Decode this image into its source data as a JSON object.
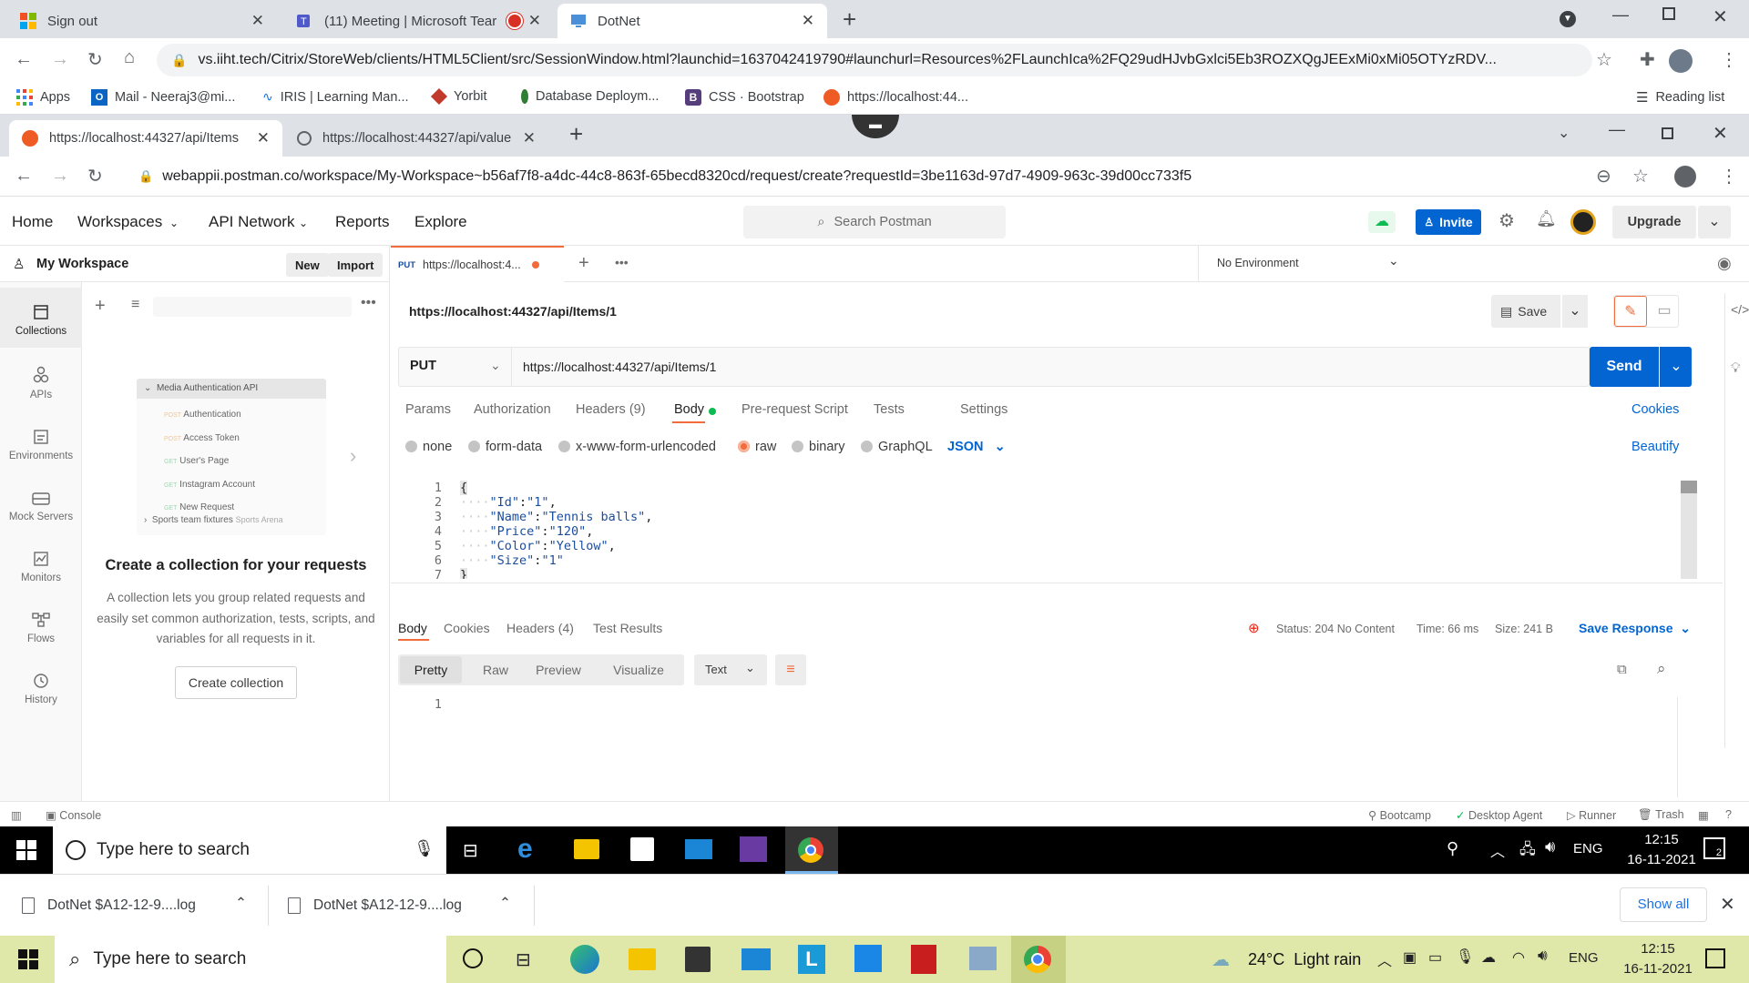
{
  "outer_browser": {
    "tabs": [
      {
        "title": "Sign out"
      },
      {
        "title": "(11) Meeting | Microsoft Tear"
      },
      {
        "title": "DotNet"
      }
    ],
    "url": "vs.iiht.tech/Citrix/StoreWeb/clients/HTML5Client/src/SessionWindow.html?launchid=1637042419790#launchurl=Resources%2FLaunchIca%2FQ29udHJvbGxlci5Eb3ROZXQgJEExMi0xMi05OTYzRDV...",
    "bookmarks": [
      {
        "label": "Apps"
      },
      {
        "label": "Mail - Neeraj3@mi..."
      },
      {
        "label": "IRIS | Learning Man..."
      },
      {
        "label": "Yorbit"
      },
      {
        "label": "Database Deploym..."
      },
      {
        "label": "CSS · Bootstrap"
      },
      {
        "label": "https://localhost:44..."
      }
    ],
    "reading_list": "Reading list"
  },
  "inner_browser": {
    "tabs": [
      {
        "title": "https://localhost:44327/api/Items"
      },
      {
        "title": "https://localhost:44327/api/value"
      }
    ],
    "url": "webappii.postman.co/workspace/My-Workspace~b56af7f8-a4dc-44c8-863f-65becd8320cd/request/create?requestId=3be1163d-97d7-4909-963c-39d00cc733f5"
  },
  "postman": {
    "nav": [
      "Home",
      "Workspaces",
      "API Network",
      "Reports",
      "Explore"
    ],
    "search_placeholder": "Search Postman",
    "invite": "Invite",
    "upgrade": "Upgrade",
    "workspace": {
      "title": "My Workspace",
      "new": "New",
      "import": "Import"
    },
    "rail": [
      "Collections",
      "APIs",
      "Environments",
      "Mock Servers",
      "Monitors",
      "Flows",
      "History"
    ],
    "illustration": {
      "folder": "Media Authentication API",
      "items": [
        {
          "method": "POST",
          "name": "Authentication"
        },
        {
          "method": "POST",
          "name": "Access Token"
        },
        {
          "method": "GET",
          "name": "User's Page"
        },
        {
          "method": "GET",
          "name": "Instagram Account"
        },
        {
          "method": "GET",
          "name": "New Request"
        }
      ],
      "folder2": "Sports team fixtures",
      "folder2_tag": "Sports Arena"
    },
    "empty_state": {
      "title": "Create a collection for your requests",
      "text": "A collection lets you group related requests and easily set common authorization, tests, scripts, and variables for all requests in it.",
      "button": "Create collection"
    },
    "request_tab": {
      "method": "PUT",
      "label": "https://localhost:4..."
    },
    "environment": "No Environment",
    "request_title": "https://localhost:44327/api/Items/1",
    "save": "Save",
    "method": "PUT",
    "url": "https://localhost:44327/api/Items/1",
    "send": "Send",
    "request_tabs": [
      "Params",
      "Authorization",
      "Headers (9)",
      "Body",
      "Pre-request Script",
      "Tests",
      "Settings"
    ],
    "cookies": "Cookies",
    "body_types": [
      "none",
      "form-data",
      "x-www-form-urlencoded",
      "raw",
      "binary",
      "GraphQL"
    ],
    "body_format": "JSON",
    "beautify": "Beautify",
    "body_lines": [
      {
        "n": "1",
        "text": "{"
      },
      {
        "n": "2",
        "key": "\"Id\"",
        "val": "\"1\"",
        "comma": ","
      },
      {
        "n": "3",
        "key": "\"Name\"",
        "val": "\"Tennis balls\"",
        "comma": ","
      },
      {
        "n": "4",
        "key": "\"Price\"",
        "val": "\"120\"",
        "comma": ","
      },
      {
        "n": "5",
        "key": "\"Color\"",
        "val": "\"Yellow\"",
        "comma": ","
      },
      {
        "n": "6",
        "key": "\"Size\"",
        "val": "\"1\"",
        "comma": ""
      },
      {
        "n": "7",
        "text": "}"
      }
    ],
    "response_tabs": [
      "Body",
      "Cookies",
      "Headers (4)",
      "Test Results"
    ],
    "status": "Status: 204 No Content",
    "time": "Time: 66 ms",
    "size": "Size: 241 B",
    "save_response": "Save Response",
    "view_modes": [
      "Pretty",
      "Raw",
      "Preview",
      "Visualize"
    ],
    "view_format": "Text",
    "response_line": "1",
    "status_bar": {
      "console": "Console",
      "right": [
        "Bootcamp",
        "Desktop Agent",
        "Runner",
        "Trash"
      ]
    }
  },
  "citrix_taskbar": {
    "search": "Type here to search",
    "lang": "ENG",
    "time": "12:15",
    "date": "16-11-2021",
    "notif": "2"
  },
  "downloads": {
    "items": [
      "DotNet $A12-12-9....log",
      "DotNet $A12-12-9....log"
    ],
    "show_all": "Show all"
  },
  "host_taskbar": {
    "search": "Type here to search",
    "weather": "24°C  Light rain",
    "lang": "ENG",
    "time": "12:15",
    "date": "16-11-2021"
  },
  "colors": {
    "accent": "#0265d2",
    "orange": "#f26b3a",
    "green": "#0cbb52"
  }
}
